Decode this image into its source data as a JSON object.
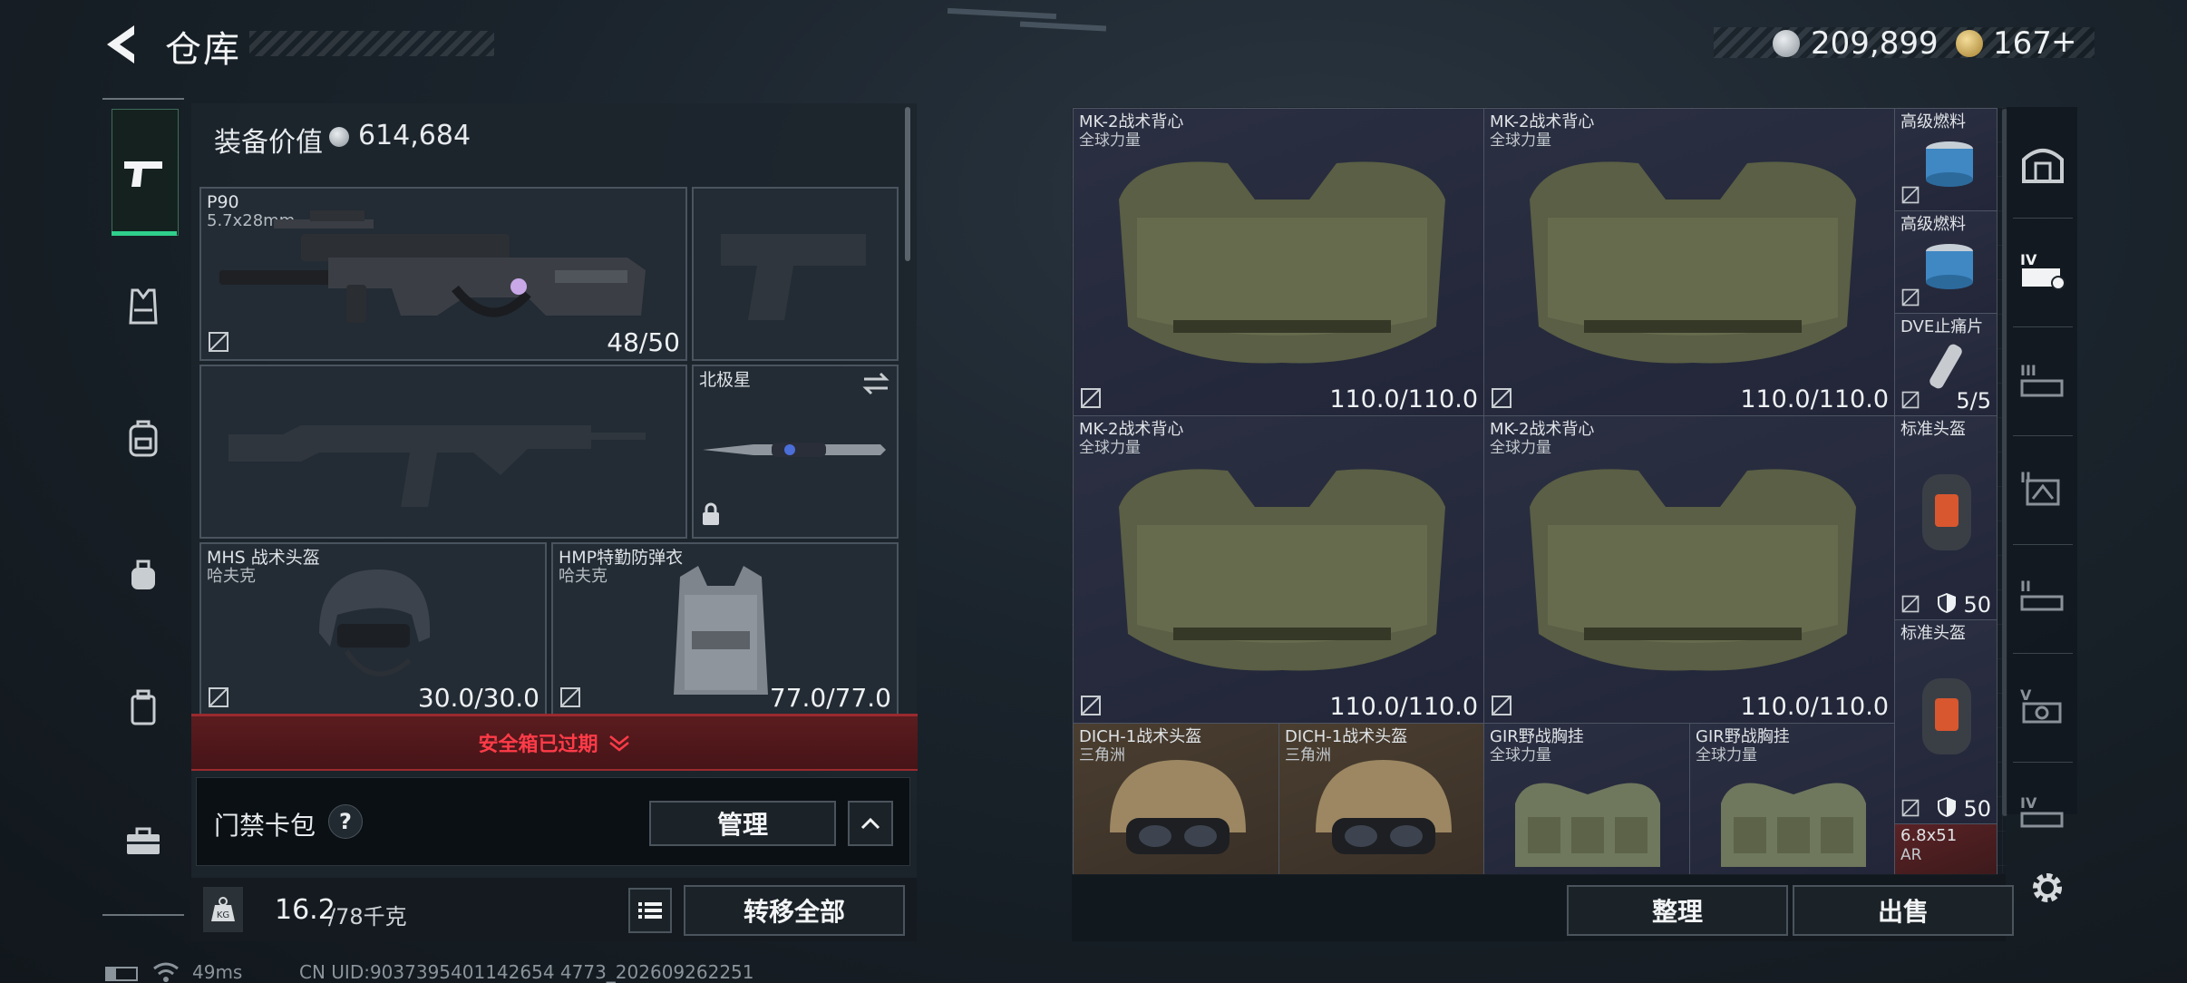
{
  "header": {
    "title": "仓库",
    "currency_silver": "209,899",
    "currency_gold": "167",
    "plus": "+"
  },
  "left_panel": {
    "equip_value_label": "装备价值",
    "equip_value": "614,684",
    "primary_weapon": {
      "name": "P90",
      "caliber": "5.7x28mm",
      "ammo": "48/50"
    },
    "melee": {
      "name": "北极星"
    },
    "helmet": {
      "name": "MHS 战术头盔",
      "brand": "哈夫克",
      "durability": "30.0/30.0"
    },
    "armor": {
      "name": "HMP特勤防弹衣",
      "brand": "哈夫克",
      "durability": "77.0/77.0"
    },
    "safe_box_status": "安全箱已过期",
    "keycard": {
      "label": "门禁卡包",
      "help": "?",
      "manage": "管理"
    },
    "weight": {
      "current": "16.2",
      "max": "/78千克"
    },
    "transfer_all": "转移全部"
  },
  "storage": {
    "items": [
      {
        "name": "MK-2战术背心",
        "brand": "全球力量",
        "value": "110.0/110.0"
      },
      {
        "name": "MK-2战术背心",
        "brand": "全球力量",
        "value": "110.0/110.0"
      },
      {
        "name": "MK-2战术背心",
        "brand": "全球力量",
        "value": "110.0/110.0"
      },
      {
        "name": "MK-2战术背心",
        "brand": "全球力量",
        "value": "110.0/110.0"
      },
      {
        "name": "高级燃料"
      },
      {
        "name": "高级燃料"
      },
      {
        "name": "DVE止痛片",
        "value": "5/5"
      },
      {
        "name": "标准头盔",
        "value": "50"
      },
      {
        "name": "标准头盔",
        "value": "50"
      },
      {
        "name": "DICH-1战术头盔",
        "brand": "三角洲"
      },
      {
        "name": "DICH-1战术头盔",
        "brand": "三角洲"
      },
      {
        "name": "GIR野战胸挂",
        "brand": "全球力量"
      },
      {
        "name": "GIR野战胸挂",
        "brand": "全球力量"
      },
      {
        "name": "6.8x51",
        "brand": "AR"
      }
    ],
    "sort_button": "整理",
    "sell_button": "出售"
  },
  "footer": {
    "ping": "49ms",
    "uid": "CN UID:9037395401142654 4773_202609262251"
  },
  "colors": {
    "accent_green": "#2fcf8c",
    "alert_red": "#ff3b48"
  }
}
